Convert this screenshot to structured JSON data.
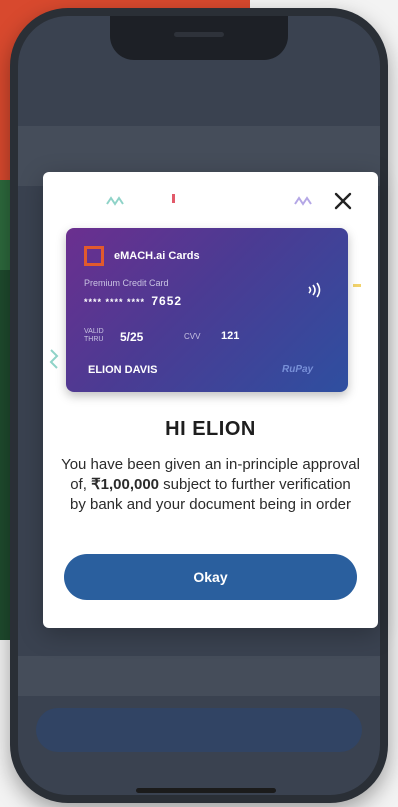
{
  "card": {
    "brand": "eMACH.ai Cards",
    "type": "Premium Credit Card",
    "number_mask": "**** **** ****",
    "number_last4": "7652",
    "valid_label": "VALID THRU",
    "valid": "5/25",
    "cvv_label": "CVV",
    "cvv": "121",
    "holder": "ELION DAVIS",
    "network": "RuPay"
  },
  "modal": {
    "greeting": "HI ELION",
    "message_before": "You have been given an in-principle approval of, ",
    "amount": "₹1,00,000",
    "message_after": " subject to further verification by bank and your document being in order",
    "button_label": "Okay"
  },
  "colors": {
    "accent_button": "#2a5f9e",
    "card_logo": "#e25a2c",
    "background_red": "#d8492e",
    "background_green": "#1f4b2e"
  }
}
